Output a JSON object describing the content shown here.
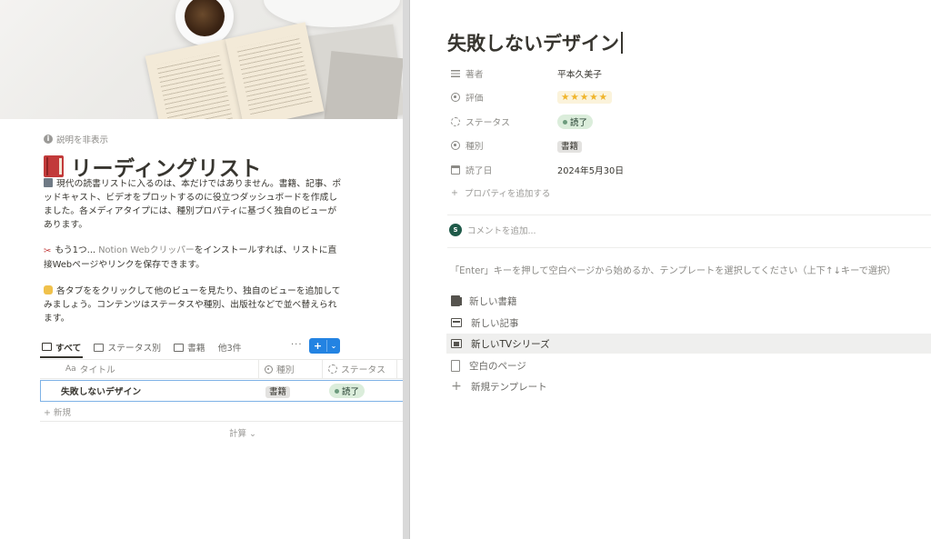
{
  "left": {
    "hide_description": "説明を非表示",
    "title": "リーディングリスト",
    "desc1": "現代の読書リストに入るのは、本だけではありません。書籍、記事、ポッドキャスト、ビデオをプロットするのに役立つダッシュボードを作成しました。各メディアタイプには、種別プロパティに基づく独自のビューがあります。",
    "desc2_prefix": "もう1つ... ",
    "desc2_muted": "Notion Webクリッパー",
    "desc2_suffix": "をインストールすれば、リストに直接Webページやリンクを保存できます。",
    "desc3": "各タブををクリックして他のビューを見たり、独自のビューを追加してみましょう。コンテンツはステータスや種別、出版社などで並べ替えられます。",
    "tabs": [
      {
        "label": "すべて"
      },
      {
        "label": "ステータス別"
      },
      {
        "label": "書籍"
      },
      {
        "label": "他3件"
      }
    ],
    "more": "···",
    "new_button": "+",
    "table": {
      "headers": [
        "タイトル",
        "種別",
        "ステータス"
      ],
      "title_prefix": "Aa",
      "rows": [
        {
          "title": "失敗しないデザイン",
          "type": "書籍",
          "status": "読了"
        }
      ],
      "new_row": "+ 新規",
      "calculate": "計算 ⌄"
    }
  },
  "right": {
    "title": "失敗しないデザイン",
    "props": [
      {
        "name": "著者",
        "value": "平本久美子",
        "icon": "text-lines-icon"
      },
      {
        "name": "評価",
        "value": "★★★★★",
        "icon": "select-icon"
      },
      {
        "name": "ステータス",
        "value": "読了",
        "icon": "status-icon"
      },
      {
        "name": "種別",
        "value": "書籍",
        "icon": "select-icon"
      },
      {
        "name": "読了日",
        "value": "2024年5月30日",
        "icon": "calendar-icon"
      }
    ],
    "add_property": "プロパティを追加する",
    "comment_avatar": "S",
    "comment_placeholder": "コメントを追加...",
    "hint": "「Enter」キーを押して空白ページから始めるか、テンプレートを選択してください（上下↑↓キーで選択）",
    "templates": [
      {
        "label": "新しい書籍",
        "icon": "book-icon"
      },
      {
        "label": "新しい記事",
        "icon": "newspaper-icon"
      },
      {
        "label": "新しいTVシリーズ",
        "icon": "film-icon"
      },
      {
        "label": "空白のページ",
        "icon": "page-icon"
      },
      {
        "label": "新規テンプレート",
        "icon": "plus-icon"
      }
    ]
  },
  "colors": {
    "accent": "#2383e2",
    "status_green_bg": "#dbeddb",
    "tag_gray_bg": "#e3e2e0",
    "star": "#f0b429"
  }
}
